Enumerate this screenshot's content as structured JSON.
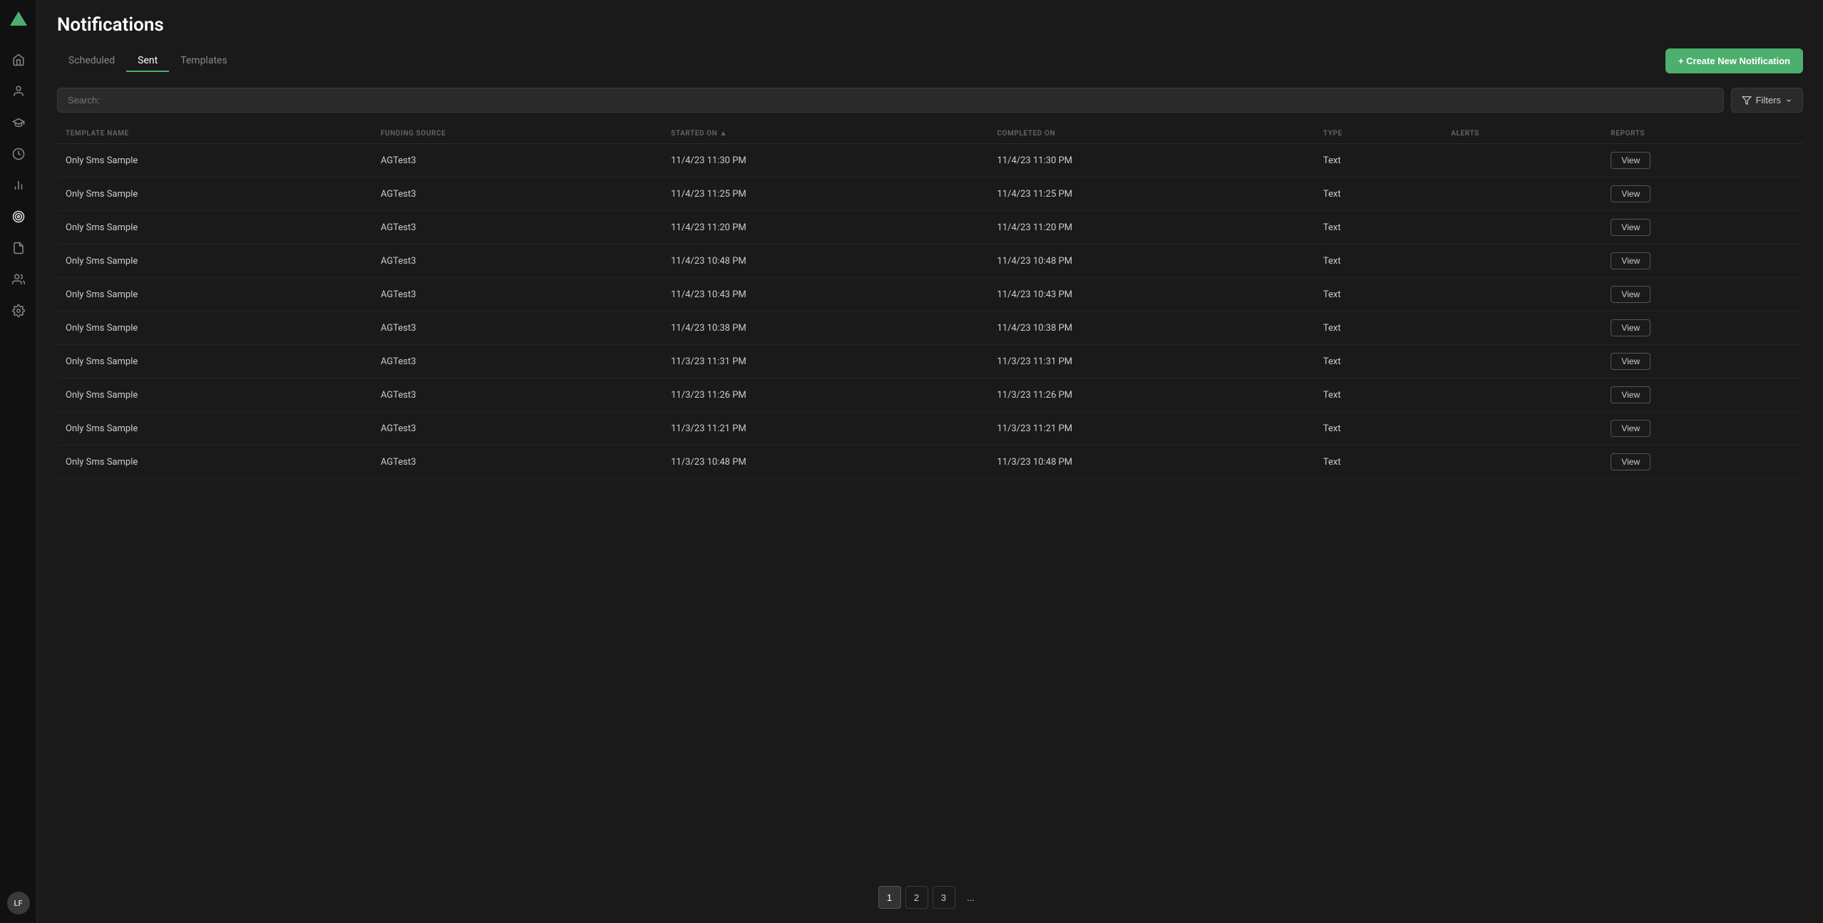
{
  "page": {
    "title": "Notifications"
  },
  "sidebar": {
    "logo_label": "Logo",
    "avatar": "LF",
    "icons": [
      {
        "name": "home-icon",
        "symbol": "⊞"
      },
      {
        "name": "person-icon",
        "symbol": "👤"
      },
      {
        "name": "graduation-icon",
        "symbol": "🎓"
      },
      {
        "name": "clock-icon",
        "symbol": "🕐"
      },
      {
        "name": "chart-icon",
        "symbol": "📊"
      },
      {
        "name": "target-icon",
        "symbol": "◎"
      },
      {
        "name": "document-icon",
        "symbol": "📄"
      },
      {
        "name": "group-icon",
        "symbol": "👥"
      },
      {
        "name": "settings-icon",
        "symbol": "⚙"
      }
    ]
  },
  "tabs": [
    {
      "label": "Scheduled",
      "active": false
    },
    {
      "label": "Sent",
      "active": true
    },
    {
      "label": "Templates",
      "active": false
    }
  ],
  "create_button": "+ Create New Notification",
  "search": {
    "placeholder": "Search:"
  },
  "filter_button": "Filters",
  "table": {
    "columns": [
      {
        "key": "template_name",
        "label": "TEMPLATE NAME"
      },
      {
        "key": "funding_source",
        "label": "FUNDING SOURCE"
      },
      {
        "key": "started_on",
        "label": "STARTED ON ▲"
      },
      {
        "key": "completed_on",
        "label": "COMPLETED ON"
      },
      {
        "key": "type",
        "label": "TYPE"
      },
      {
        "key": "alerts",
        "label": "ALERTS"
      },
      {
        "key": "reports",
        "label": "REPORTS"
      }
    ],
    "rows": [
      {
        "template_name": "Only Sms Sample",
        "funding_source": "AGTest3",
        "started_on": "11/4/23 11:30 PM",
        "completed_on": "11/4/23 11:30 PM",
        "type": "Text",
        "alerts": "",
        "reports": "View"
      },
      {
        "template_name": "Only Sms Sample",
        "funding_source": "AGTest3",
        "started_on": "11/4/23 11:25 PM",
        "completed_on": "11/4/23 11:25 PM",
        "type": "Text",
        "alerts": "",
        "reports": "View"
      },
      {
        "template_name": "Only Sms Sample",
        "funding_source": "AGTest3",
        "started_on": "11/4/23 11:20 PM",
        "completed_on": "11/4/23 11:20 PM",
        "type": "Text",
        "alerts": "",
        "reports": "View"
      },
      {
        "template_name": "Only Sms Sample",
        "funding_source": "AGTest3",
        "started_on": "11/4/23 10:48 PM",
        "completed_on": "11/4/23 10:48 PM",
        "type": "Text",
        "alerts": "",
        "reports": "View"
      },
      {
        "template_name": "Only Sms Sample",
        "funding_source": "AGTest3",
        "started_on": "11/4/23 10:43 PM",
        "completed_on": "11/4/23 10:43 PM",
        "type": "Text",
        "alerts": "",
        "reports": "View"
      },
      {
        "template_name": "Only Sms Sample",
        "funding_source": "AGTest3",
        "started_on": "11/4/23 10:38 PM",
        "completed_on": "11/4/23 10:38 PM",
        "type": "Text",
        "alerts": "",
        "reports": "View"
      },
      {
        "template_name": "Only Sms Sample",
        "funding_source": "AGTest3",
        "started_on": "11/3/23 11:31 PM",
        "completed_on": "11/3/23 11:31 PM",
        "type": "Text",
        "alerts": "",
        "reports": "View"
      },
      {
        "template_name": "Only Sms Sample",
        "funding_source": "AGTest3",
        "started_on": "11/3/23 11:26 PM",
        "completed_on": "11/3/23 11:26 PM",
        "type": "Text",
        "alerts": "",
        "reports": "View"
      },
      {
        "template_name": "Only Sms Sample",
        "funding_source": "AGTest3",
        "started_on": "11/3/23 11:21 PM",
        "completed_on": "11/3/23 11:21 PM",
        "type": "Text",
        "alerts": "",
        "reports": "View"
      },
      {
        "template_name": "Only Sms Sample",
        "funding_source": "AGTest3",
        "started_on": "11/3/23 10:48 PM",
        "completed_on": "11/3/23 10:48 PM",
        "type": "Text",
        "alerts": "",
        "reports": "View"
      }
    ]
  },
  "pagination": {
    "pages": [
      "1",
      "2",
      "3",
      "..."
    ],
    "active_page": "1"
  }
}
